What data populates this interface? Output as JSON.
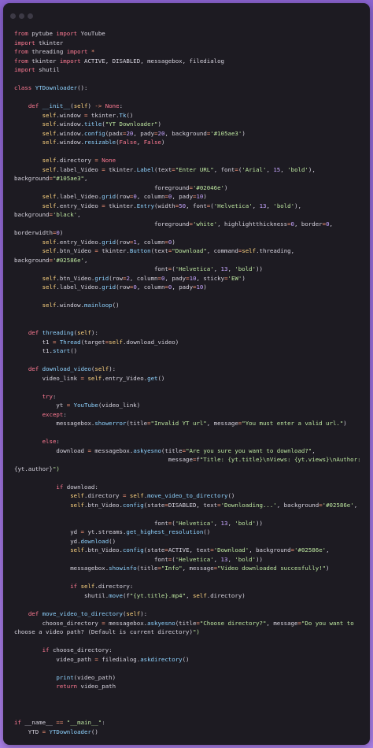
{
  "colors": {
    "background": "#9b6fdc",
    "editor_bg": "#1d1b22",
    "keyword": "#ff7a93",
    "string": "#bde6a0",
    "number": "#c6a6ff",
    "self": "#ffd580",
    "attribute": "#69c3f2",
    "text": "#d6d3de"
  },
  "window": {
    "controls": [
      "close-dot",
      "minimize-dot",
      "maximize-dot"
    ]
  },
  "code": {
    "lines": [
      "from pytube import YouTube",
      "import tkinter",
      "from threading import *",
      "from tkinter import ACTIVE, DISABLED, messagebox, filedialog",
      "import shutil",
      "",
      "class YTDownloader():",
      "",
      "    def __init__(self) -> None:",
      "        self.window = tkinter.Tk()",
      "        self.window.title(\"YT Downloader\")",
      "        self.window.config(padx=20, pady=20, background='#105ae3')",
      "        self.window.resizable(False, False)",
      "",
      "        self.directory = None",
      "        self.label_Video = tkinter.Label(text=\"Enter URL\", font=('Arial', 15, 'bold'),",
      "background=\"#105ae3\",",
      "                                        foreground='#02046e')",
      "        self.label_Video.grid(row=0, column=0, pady=10)",
      "        self.entry_Video = tkinter.Entry(width=50, font=('Helvetica', 13, 'bold'),",
      "background='black',",
      "                                        foreground='white', highlightthickness=0, border=0,",
      "borderwidth=0)",
      "        self.entry_Video.grid(row=1, column=0)",
      "        self.btn_Video = tkinter.Button(text=\"Download\", command=self.threading,",
      "background='#02586e',",
      "                                        font=('Helvetica', 13, 'bold'))",
      "        self.btn_Video.grid(row=2, column=0, pady=10, sticky='EW')",
      "        self.label_Video.grid(row=0, column=0, pady=10)",
      "",
      "        self.window.mainloop()",
      "",
      "",
      "    def threading(self):",
      "        t1 = Thread(target=self.download_video)",
      "        t1.start()",
      "",
      "    def download_video(self):",
      "        video_link = self.entry_Video.get()",
      "",
      "        try:",
      "            yt = YouTube(video_link)",
      "        except:",
      "            messagebox.showerror(title=\"Invalid YT url\", message=\"You must enter a valid url.\")",
      "",
      "        else:",
      "            download = messagebox.askyesno(title=\"Are you sure you want to download?\",",
      "                                            message=f\"Title: {yt.title}\\nViews: {yt.views}\\nAuthor:",
      "{yt.author}\")",
      "",
      "            if download:",
      "                self.directory = self.move_video_to_directory()",
      "                self.btn_Video.config(state=DISABLED, text='Downloading...', background='#02586e',",
      "",
      "                                        font=('Helvetica', 13, 'bold'))",
      "                yd = yt.streams.get_highest_resolution()",
      "                yd.download()",
      "                self.btn_Video.config(state=ACTIVE, text='Download', background='#02586e',",
      "                                        font=('Helvetica', 13, 'bold'))",
      "                messagebox.showinfo(title=\"Info\", message=\"Video downloaded succesfully!\")",
      "",
      "                if self.directory:",
      "                    shutil.move(f\"{yt.title}.mp4\", self.directory)",
      "",
      "    def move_video_to_directory(self):",
      "        choose_directory = messagebox.askyesno(title=\"Choose directory?\", message=\"Do you want to",
      "choose a video path? (Default is current directory)\")",
      "",
      "        if choose_directory:",
      "            video_path = filedialog.askdirectory()",
      "",
      "            print(video_path)",
      "            return video_path",
      "",
      "",
      "",
      "if __name__ == \"__main__\":",
      "    YTD = YTDownloader()"
    ]
  }
}
